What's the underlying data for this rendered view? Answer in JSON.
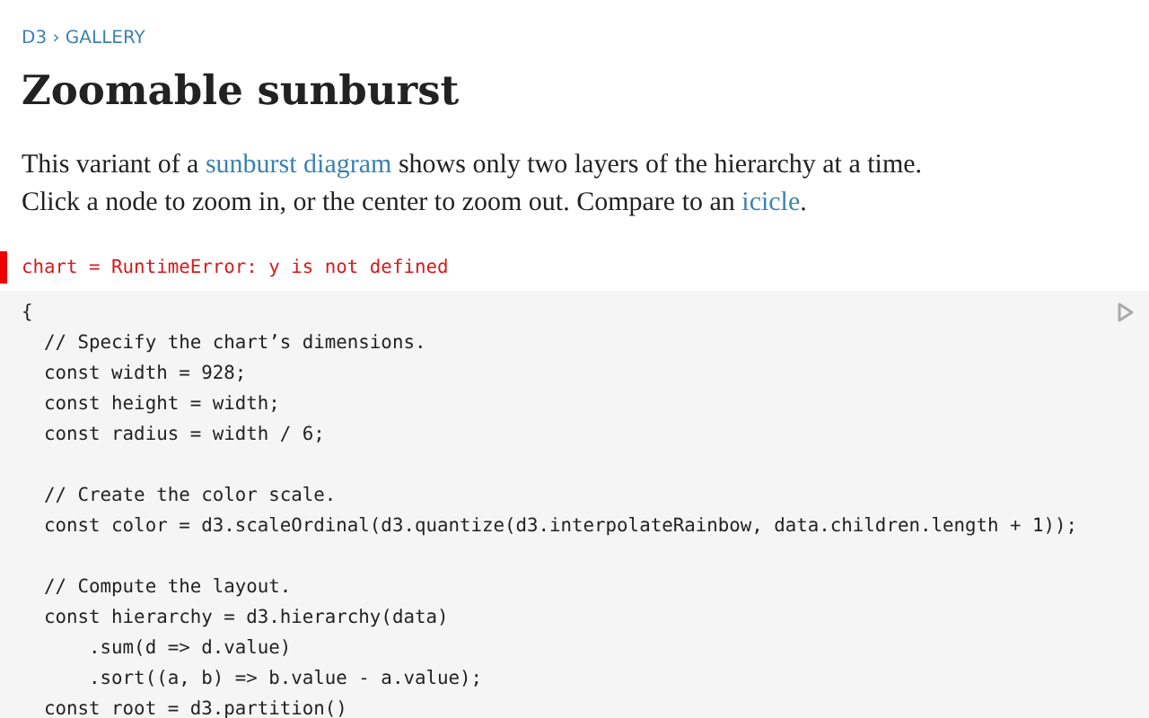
{
  "breadcrumb": [
    {
      "text": "D3"
    },
    {
      "text": "GALLERY"
    }
  ],
  "breadcrumb_separator": "›",
  "title": "Zoomable sunburst",
  "intro": [
    [
      {
        "kind": "text",
        "text": "This variant of a "
      },
      {
        "kind": "link",
        "text": "sunburst diagram"
      },
      {
        "kind": "text",
        "text": " shows only two layers of the hierarchy at a time."
      }
    ],
    [
      {
        "kind": "text",
        "text": "Click a node to zoom in, or the center to zoom out. Compare to an "
      },
      {
        "kind": "link",
        "text": "icicle"
      },
      {
        "kind": "text",
        "text": "."
      }
    ]
  ],
  "cell_output": {
    "kind": "error",
    "text": "chart = RuntimeError: y is not defined"
  },
  "code_blocks": [
    [
      "{",
      "  // Specify the chart’s dimensions.",
      "  const width = 928;",
      "  const height = width;",
      "  const radius = width / 6;"
    ],
    [
      "  // Create the color scale.",
      "  const color = d3.scaleOrdinal(d3.quantize(d3.interpolateRainbow, data.children.length + 1));"
    ],
    [
      "  // Compute the layout.",
      "  const hierarchy = d3.hierarchy(data)",
      "      .sum(d => d.value)",
      "      .sort((a, b) => b.value - a.value);",
      "  const root = d3.partition()"
    ]
  ]
}
